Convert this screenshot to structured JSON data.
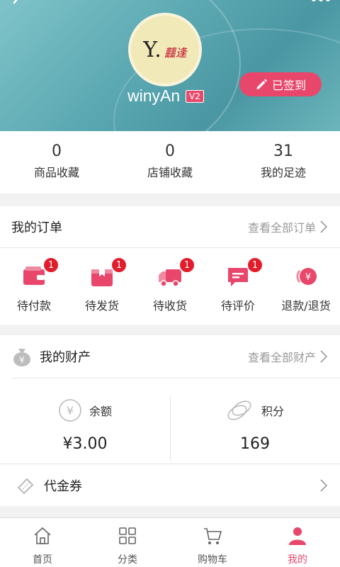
{
  "header": {
    "username": "winyAn",
    "vip_level": "V2",
    "avatar_signature": "Y.",
    "avatar_signature_red": "䨻逢",
    "signed_label": "已签到"
  },
  "stats": [
    {
      "value": "0",
      "label": "商品收藏"
    },
    {
      "value": "0",
      "label": "店铺收藏"
    },
    {
      "value": "31",
      "label": "我的足迹"
    }
  ],
  "orders": {
    "title": "我的订单",
    "view_all": "查看全部订单",
    "items": [
      {
        "label": "待付款",
        "badge": "1",
        "icon": "wallet-icon"
      },
      {
        "label": "待发货",
        "badge": "1",
        "icon": "package-icon"
      },
      {
        "label": "待收货",
        "badge": "1",
        "icon": "truck-icon"
      },
      {
        "label": "待评价",
        "badge": "1",
        "icon": "comment-icon"
      },
      {
        "label": "退款/退货",
        "badge": "",
        "icon": "refund-icon"
      }
    ]
  },
  "assets": {
    "title": "我的财产",
    "view_all": "查看全部财产",
    "balance_label": "余额",
    "balance_value": "¥3.00",
    "points_label": "积分",
    "points_value": "169",
    "coupon_label": "代金券"
  },
  "tabbar": [
    {
      "label": "首页",
      "icon": "home-icon"
    },
    {
      "label": "分类",
      "icon": "category-icon"
    },
    {
      "label": "购物车",
      "icon": "cart-icon"
    },
    {
      "label": "我的",
      "icon": "user-icon"
    }
  ],
  "colors": {
    "accent": "#e8476b",
    "badge": "#e11d2c",
    "header_teal": "#5aa7b1"
  }
}
